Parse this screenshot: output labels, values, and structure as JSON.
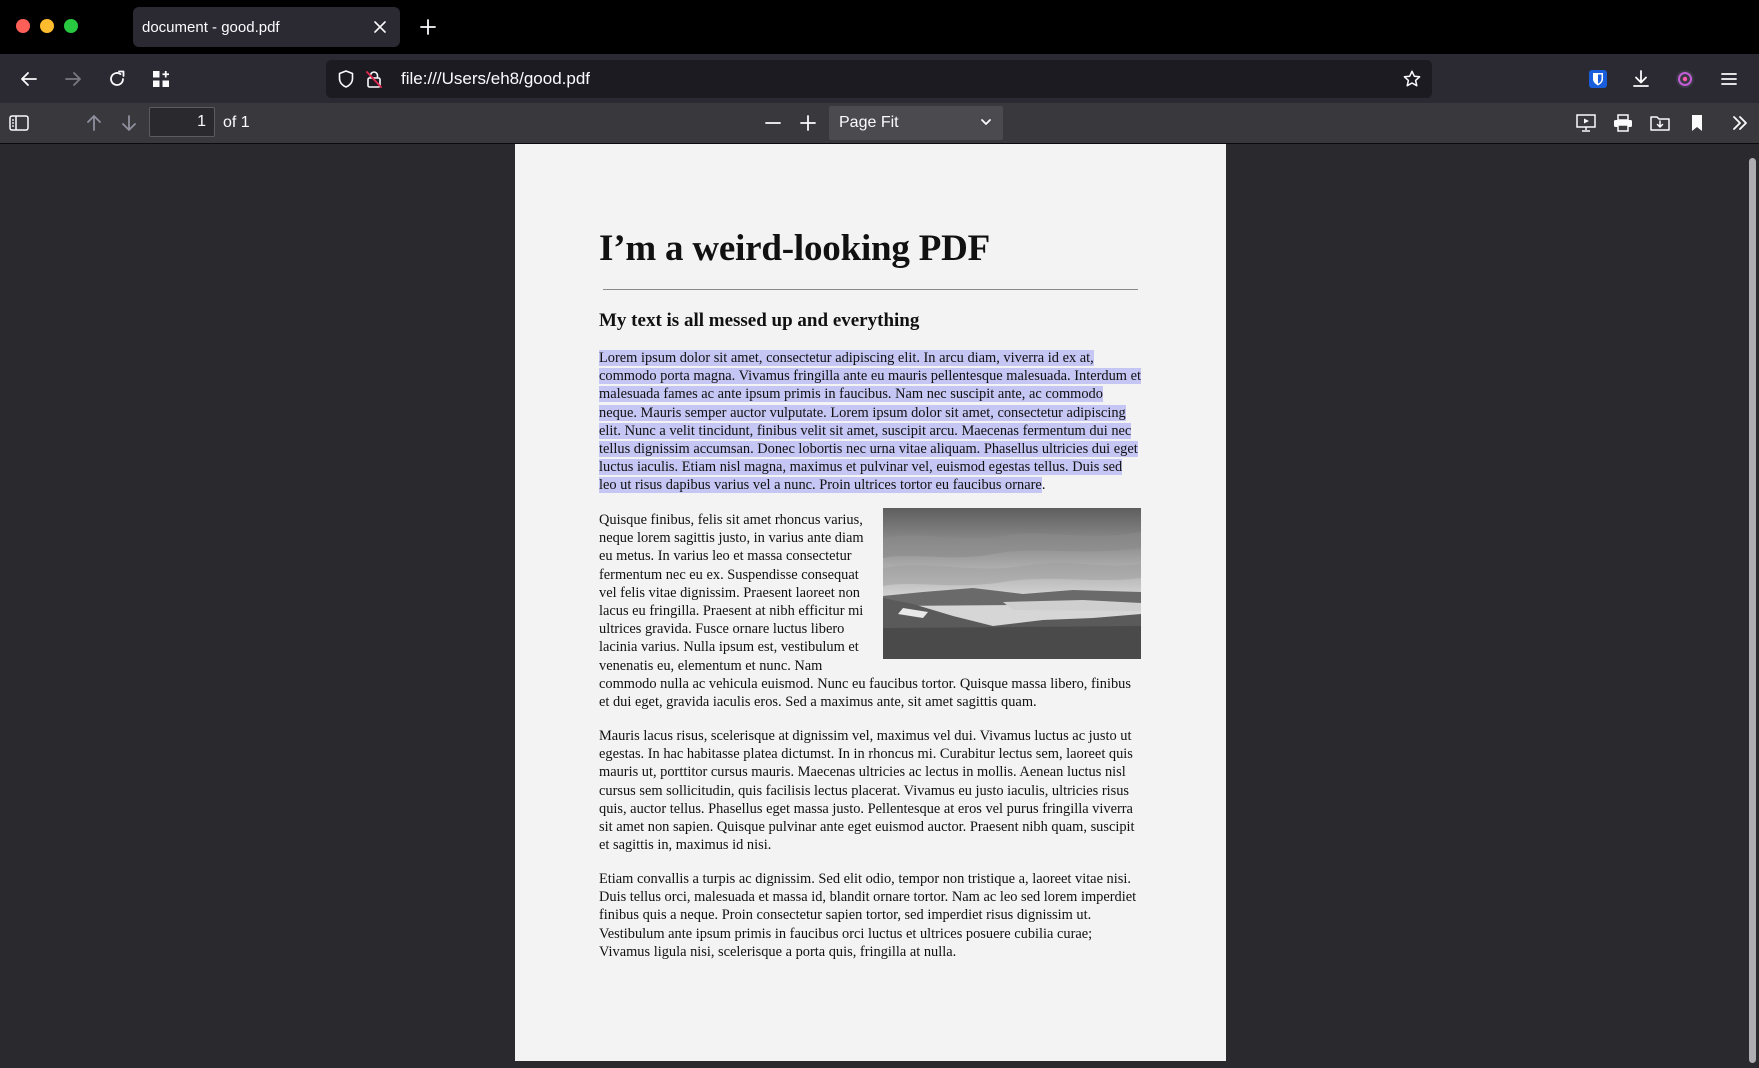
{
  "window": {
    "tab_title": "document - good.pdf"
  },
  "navbar": {
    "url": "file:///Users/eh8/good.pdf"
  },
  "pdf_toolbar": {
    "page_number": "1",
    "page_of": "of 1",
    "zoom": "Page Fit"
  },
  "document": {
    "title": "I’m a weird-looking PDF",
    "subtitle": "My text is all messed up and everything",
    "paragraph1_selected": "Lorem ipsum dolor sit amet, consectetur adipiscing elit. In arcu diam, viverra id ex at, commodo porta magna. Vivamus fringilla ante eu mauris pellentesque malesuada. Interdum et malesuada fames ac ante ipsum primis in faucibus. Nam nec suscipit ante, ac commodo neque. Mauris semper auctor vulputate. Lorem ipsum dolor sit amet, consectetur adipiscing elit. Nunc a velit tincidunt, finibus velit sit amet, suscipit arcu. Maecenas fermentum dui nec tellus dignissim accumsan. Donec lobortis nec urna vitae aliquam. Phasellus ultricies dui eget luctus iaculis. Etiam nisl magna, maximus et pulvinar vel, euismod egestas tellus. Duis sed leo ut risus dapibus varius vel a nunc. Proin ultrices tortor eu faucibus ornare",
    "paragraph1_end": ".",
    "paragraph2": "Quisque finibus, felis sit amet rhoncus varius, neque lorem sagittis justo, in varius ante diam eu metus. In varius leo et massa consectetur fermentum nec eu ex. Suspendisse consequat vel felis vitae dignissim. Praesent laoreet non lacus eu fringilla. Praesent at nibh efficitur mi ultrices gravida. Fusce ornare luctus libero lacinia varius. Nulla ipsum est, vestibulum et venenatis eu, elementum et nunc. Nam commodo nulla ac vehicula euismod. Nunc eu faucibus tortor. Quisque massa libero, finibus et dui eget, gravida iaculis eros. Sed a maximus ante, sit amet sagittis quam.",
    "paragraph3": "Mauris lacus risus, scelerisque at dignissim vel, maximus vel dui. Vivamus luctus ac justo ut egestas. In hac habitasse platea dictumst. In in rhoncus mi. Curabitur lectus sem, laoreet quis mauris ut, porttitor cursus mauris. Maecenas ultricies ac lectus in mollis. Aenean luctus nisl cursus sem sollicitudin, quis facilisis lectus placerat. Vivamus eu justo iaculis, ultricies risus quis, auctor tellus. Phasellus eget massa justo. Pellentesque at eros vel purus fringilla viverra sit amet non sapien. Quisque pulvinar ante eget euismod auctor. Praesent nibh quam, suscipit et sagittis in, maximus id nisi.",
    "paragraph4": "Etiam convallis a turpis ac dignissim. Sed elit odio, tempor non tristique a, laoreet vitae nisi. Duis tellus orci, malesuada et massa id, blandit ornare tortor. Nam ac leo sed lorem imperdiet finibus quis a neque. Proin consectetur sapien tortor, sed imperdiet risus dignissim ut. Vestibulum ante ipsum primis in faucibus orci luctus et ultrices posuere cubilia curae; Vivamus ligula nisi, scelerisque a porta quis, fringilla at nulla."
  },
  "colors": {
    "selection": "#c5c6f4",
    "tab_bg": "#2b2a33",
    "toolbar_bg": "#38383d",
    "viewer_bg": "#2a2a2e"
  },
  "icons": [
    "close-icon",
    "plus-icon",
    "back-arrow-icon",
    "forward-arrow-icon",
    "reload-icon",
    "extensions-icon",
    "shield-icon",
    "insecure-lock-icon",
    "star-icon",
    "bitwarden-icon",
    "download-icon",
    "profile-icon",
    "menu-icon",
    "sidebar-toggle-icon",
    "page-up-icon",
    "page-down-icon",
    "zoom-out-icon",
    "zoom-in-icon",
    "chevron-down-icon",
    "presentation-icon",
    "print-icon",
    "save-icon",
    "bookmark-icon",
    "more-tools-icon"
  ]
}
